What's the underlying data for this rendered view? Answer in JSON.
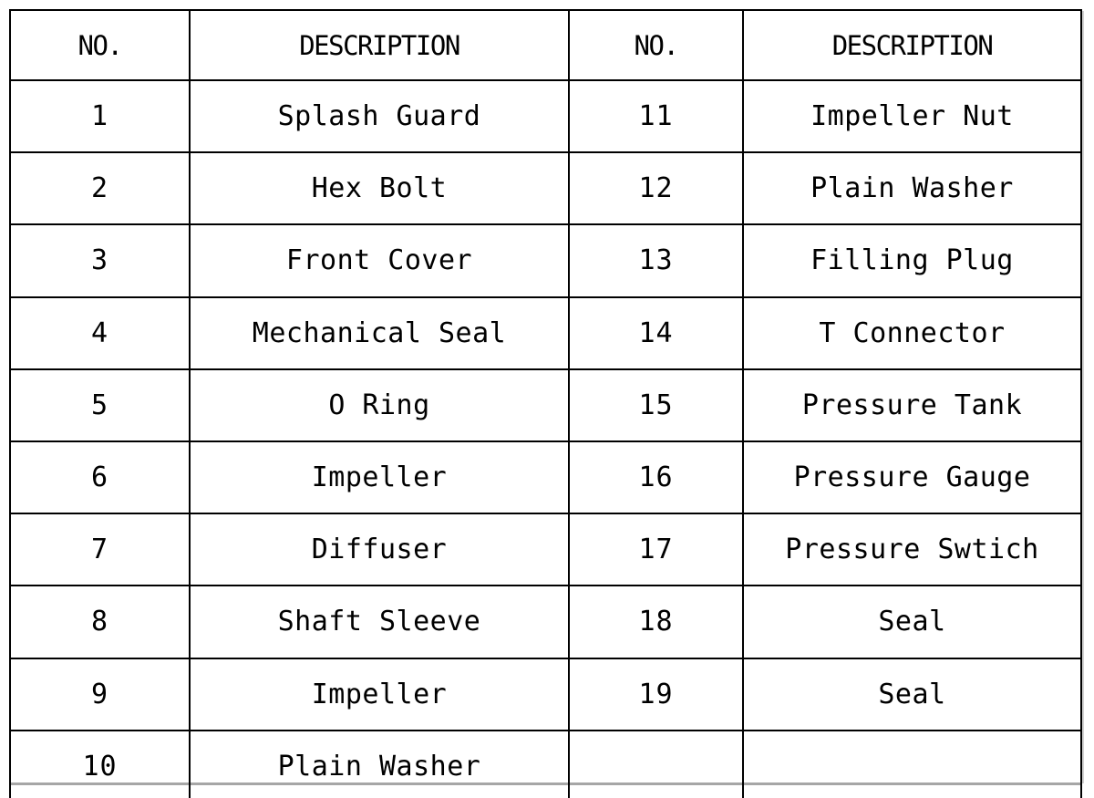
{
  "table": {
    "headers": [
      "NO.",
      "DESCRIPTION",
      "NO.",
      "DESCRIPTION"
    ],
    "rows": [
      {
        "no_left": "1",
        "desc_left": "Splash Guard",
        "no_right": "11",
        "desc_right": "Impeller Nut"
      },
      {
        "no_left": "2",
        "desc_left": "Hex Bolt",
        "no_right": "12",
        "desc_right": "Plain Washer"
      },
      {
        "no_left": "3",
        "desc_left": "Front Cover",
        "no_right": "13",
        "desc_right": "Filling Plug"
      },
      {
        "no_left": "4",
        "desc_left": "Mechanical Seal",
        "no_right": "14",
        "desc_right": "T Connector"
      },
      {
        "no_left": "5",
        "desc_left": "O Ring",
        "no_right": "15",
        "desc_right": "Pressure Tank"
      },
      {
        "no_left": "6",
        "desc_left": "Impeller",
        "no_right": "16",
        "desc_right": "Pressure Gauge"
      },
      {
        "no_left": "7",
        "desc_left": "Diffuser",
        "no_right": "17",
        "desc_right": "Pressure Swtich"
      },
      {
        "no_left": "8",
        "desc_left": "Shaft Sleeve",
        "no_right": "18",
        "desc_right": "Seal"
      },
      {
        "no_left": "9",
        "desc_left": "Impeller",
        "no_right": "19",
        "desc_right": "Seal"
      },
      {
        "no_left": "10",
        "desc_left": "Plain Washer",
        "no_right": "",
        "desc_right": ""
      }
    ]
  },
  "style": {
    "border_color": "#000000",
    "text_color": "#000000",
    "background_color": "#ffffff"
  }
}
